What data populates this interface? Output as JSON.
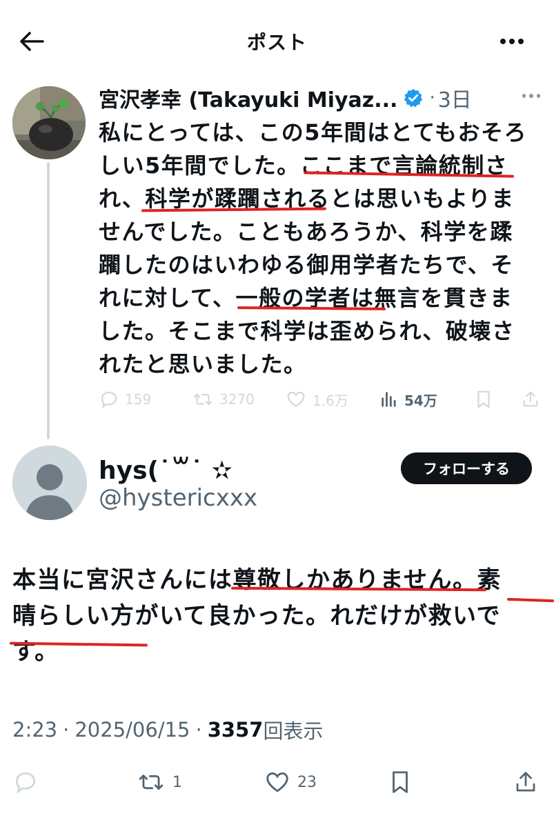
{
  "header": {
    "title": "ポスト"
  },
  "quoted_post": {
    "author_name": "宮沢孝幸 (Takayuki Miyaz...",
    "separator": "·",
    "time": "3日",
    "text_lines": [
      "私にとっては、この5年間はとてもおそろ",
      "しい5年間でした。ここまで言論統制さ",
      "れ、科学が蹂躙されるとは思いもよりま",
      "せんでした。こともあろうか、科学を蹂",
      "躙したのはいわゆる御用学者たちで、そ",
      "れに対して、一般の学者は無言を貫きま",
      "した。そこまで科学は歪められ、破壊さ",
      "れたと思いました。"
    ],
    "stats": {
      "replies": "159",
      "reposts": "3270",
      "likes": "1.6万",
      "views": "54万"
    }
  },
  "reply": {
    "name": "hys(˙꒳˙ ✫",
    "handle": "@hystericxxx",
    "follow_label": "フォローする",
    "text_lines": [
      "本当に宮沢さんには尊敬しかありません。素",
      "晴らしい方がいて良かった。れだけが救いで",
      "す。"
    ],
    "time": "2:23",
    "date": "2025/06/15",
    "dot": "·",
    "view_count": "3357",
    "view_label": "回表示",
    "reposts": "1",
    "likes": "23"
  },
  "colors": {
    "text": "#0f1419",
    "secondary": "#536471",
    "faded": "#cfd9de",
    "verified": "#1d9bf0",
    "underline": "#e02323"
  },
  "icons": [
    "back-arrow-icon",
    "more-icon",
    "verified-badge-icon",
    "reply-icon",
    "repost-icon",
    "like-icon",
    "views-icon",
    "bookmark-icon",
    "share-icon",
    "default-avatar-icon"
  ]
}
